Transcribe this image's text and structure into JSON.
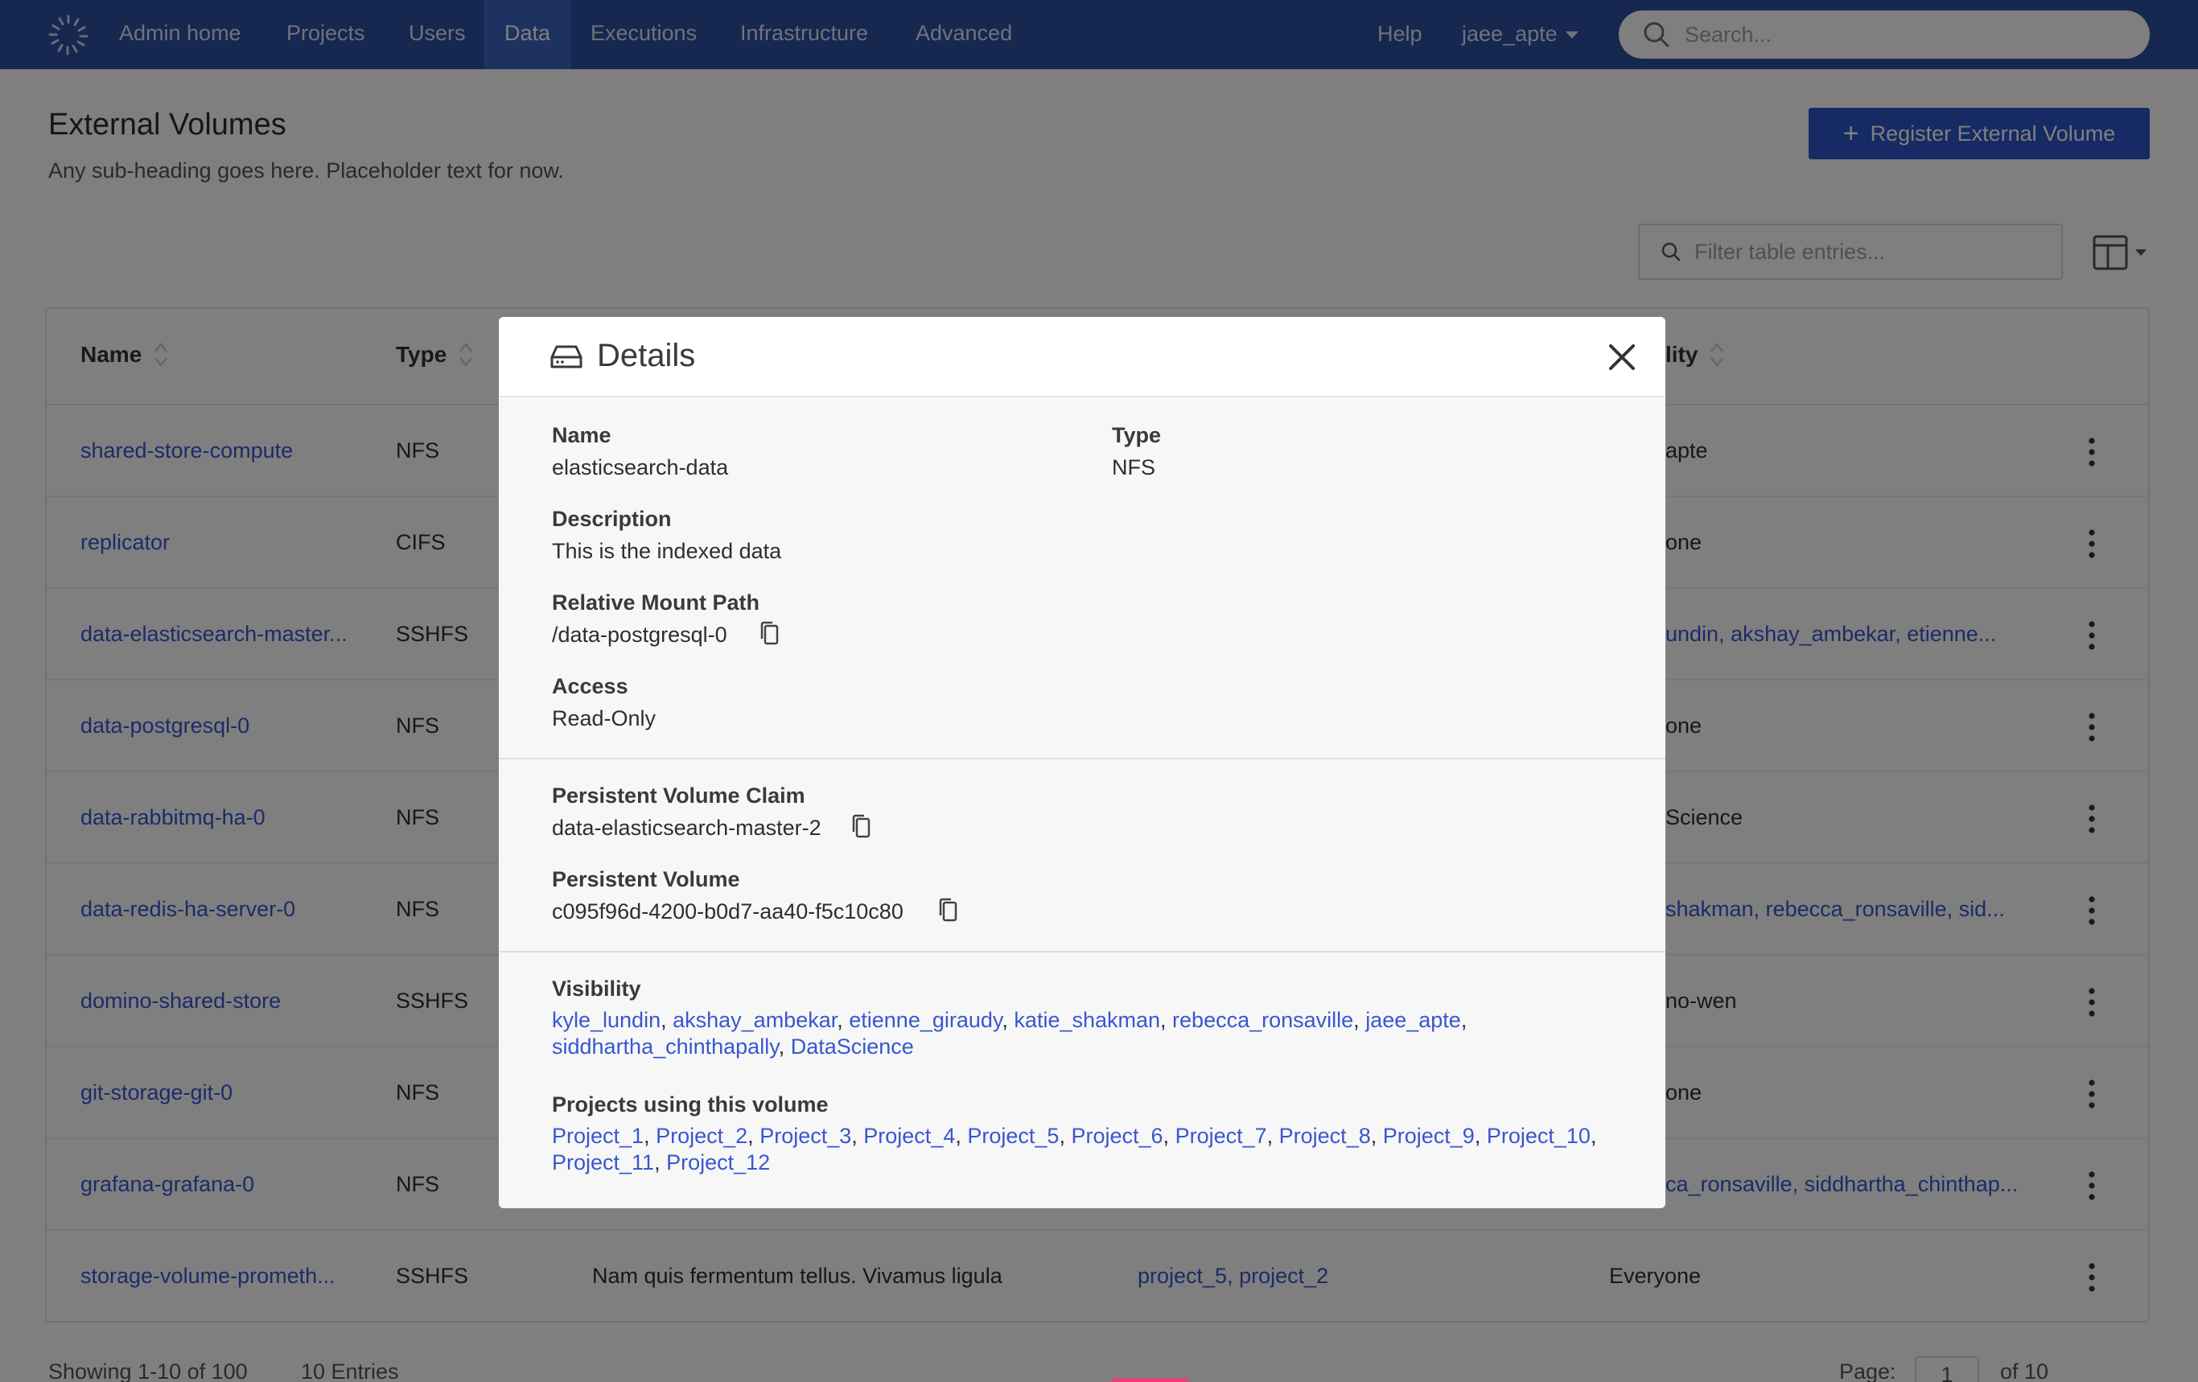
{
  "nav": {
    "items": [
      {
        "label": "Admin home",
        "active": false
      },
      {
        "label": "Projects",
        "active": false
      },
      {
        "label": "Users",
        "active": false
      },
      {
        "label": "Data",
        "active": true
      },
      {
        "label": "Executions",
        "active": false
      },
      {
        "label": "Infrastructure",
        "active": false
      },
      {
        "label": "Advanced",
        "active": false
      }
    ],
    "help": "Help",
    "user": "jaee_apte",
    "search_placeholder": "Search..."
  },
  "page": {
    "title": "External Volumes",
    "subtitle": "Any sub-heading goes here. Placeholder text for now.",
    "register_button": "Register External Volume",
    "filter_placeholder": "Filter table entries..."
  },
  "table": {
    "columns": [
      "Name",
      "Type",
      "lity"
    ],
    "rows": [
      {
        "name": "shared-store-compute",
        "type": "NFS",
        "visibility": "apte",
        "visibility_is_link": false
      },
      {
        "name": "replicator",
        "type": "CIFS",
        "visibility": "one",
        "visibility_is_link": false
      },
      {
        "name": "data-elasticsearch-master...",
        "type": "SSHFS",
        "visibility": "undin, akshay_ambekar, etienne...",
        "visibility_is_link": true
      },
      {
        "name": "data-postgresql-0",
        "type": "NFS",
        "visibility": "one",
        "visibility_is_link": false
      },
      {
        "name": "data-rabbitmq-ha-0",
        "type": "NFS",
        "visibility": "Science",
        "visibility_is_link": false
      },
      {
        "name": "data-redis-ha-server-0",
        "type": "NFS",
        "visibility": "shakman, rebecca_ronsaville, sid...",
        "visibility_is_link": true
      },
      {
        "name": "domino-shared-store",
        "type": "SSHFS",
        "visibility": "no-wen",
        "visibility_is_link": false
      },
      {
        "name": "git-storage-git-0",
        "type": "NFS",
        "visibility": "one",
        "visibility_is_link": false
      },
      {
        "name": "grafana-grafana-0",
        "type": "NFS",
        "visibility": "ca_ronsaville, siddhartha_chinthap...",
        "visibility_is_link": true
      },
      {
        "name": "storage-volume-prometh...",
        "type": "SSHFS",
        "description": "Nam quis fermentum tellus. Vivamus ligula",
        "projects": "project_5, project_2",
        "visibility": "Everyone",
        "visibility_is_link": false
      }
    ]
  },
  "footer": {
    "showing": "Showing 1-10 of 100",
    "entries": "10 Entries",
    "page_label": "Page:",
    "page_value": "1",
    "of_pages": "of 10"
  },
  "modal": {
    "title": "Details",
    "name_label": "Name",
    "name_value": "elasticsearch-data",
    "type_label": "Type",
    "type_value": "NFS",
    "description_label": "Description",
    "description_value": "This is the indexed data",
    "mount_label": "Relative Mount Path",
    "mount_value": "/data-postgresql-0",
    "access_label": "Access",
    "access_value": "Read-Only",
    "pvc_label": "Persistent Volume Claim",
    "pvc_value": "data-elasticsearch-master-2",
    "pv_label": "Persistent Volume",
    "pv_value": "c095f96d-4200-b0d7-aa40-f5c10c80",
    "visibility_label": "Visibility",
    "visibility": [
      "kyle_lundin",
      "akshay_ambekar",
      "etienne_giraudy",
      "katie_shakman",
      "rebecca_ronsaville",
      "jaee_apte",
      "siddhartha_chinthapally",
      "DataScience"
    ],
    "projects_label": "Projects using this volume",
    "projects": [
      "Project_1",
      "Project_2",
      "Project_3",
      "Project_4",
      "Project_5",
      "Project_6",
      "Project_7",
      "Project_8",
      "Project_9",
      "Project_10",
      "Project_11",
      "Project_12"
    ]
  },
  "colors": {
    "nav_bg": "#2c4ea0",
    "nav_active": "#3a64c3",
    "primary_button": "#2c54c8",
    "link": "#3857d1"
  }
}
